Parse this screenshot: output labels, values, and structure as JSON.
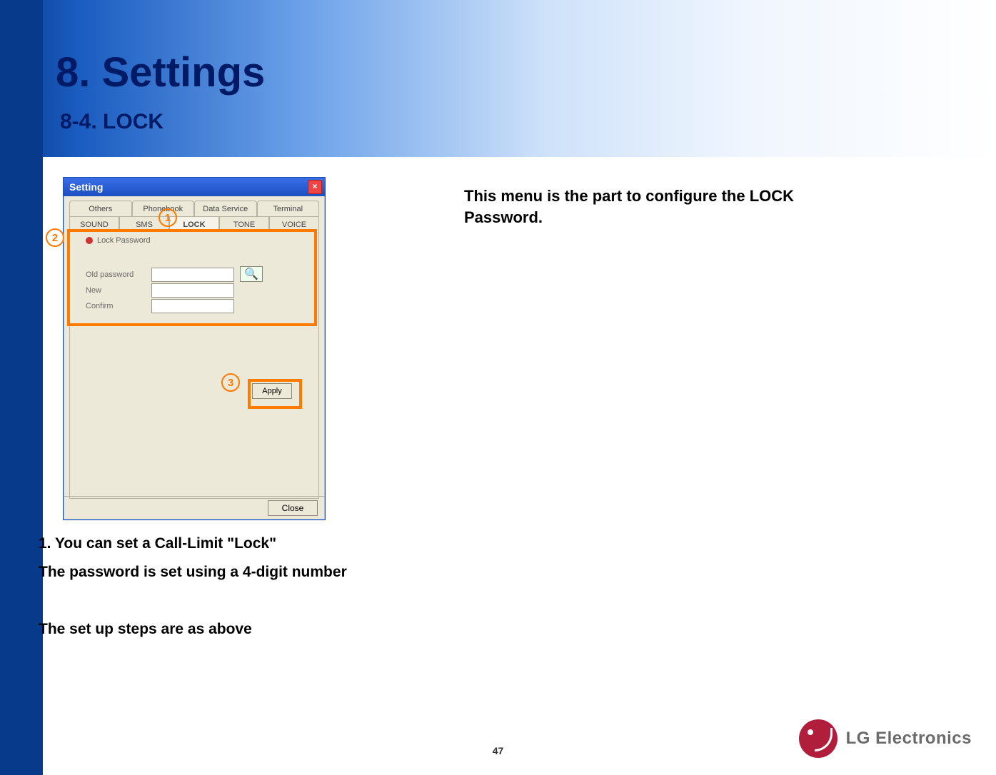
{
  "header": {
    "title": "8. Settings",
    "subtitle": "8-4. LOCK"
  },
  "window": {
    "title": "Setting",
    "close_x": "×",
    "tabs_row1": [
      "Others",
      "Phonebook",
      "Data Service",
      "Terminal"
    ],
    "tabs_row2": [
      "SOUND",
      "SMS",
      "LOCK",
      "TONE",
      "VOICE"
    ],
    "active_tab": "LOCK",
    "section_label": "Lock Password",
    "fields": {
      "old": "Old password",
      "new": "New",
      "confirm": "Confirm"
    },
    "apply_label": "Apply",
    "close_label": "Close",
    "mag_icon": "🔍"
  },
  "badges": {
    "one": "1",
    "two": "2",
    "three": "3"
  },
  "captions": {
    "c1": "1. You can set a Call-Limit \"Lock\"",
    "c2": "The password is set using a 4-digit number",
    "c3": "The set up steps are as above"
  },
  "rightnote": "This menu is the part to configure  the LOCK Password.",
  "page_number": "47",
  "logo_text": "LG Electronics"
}
